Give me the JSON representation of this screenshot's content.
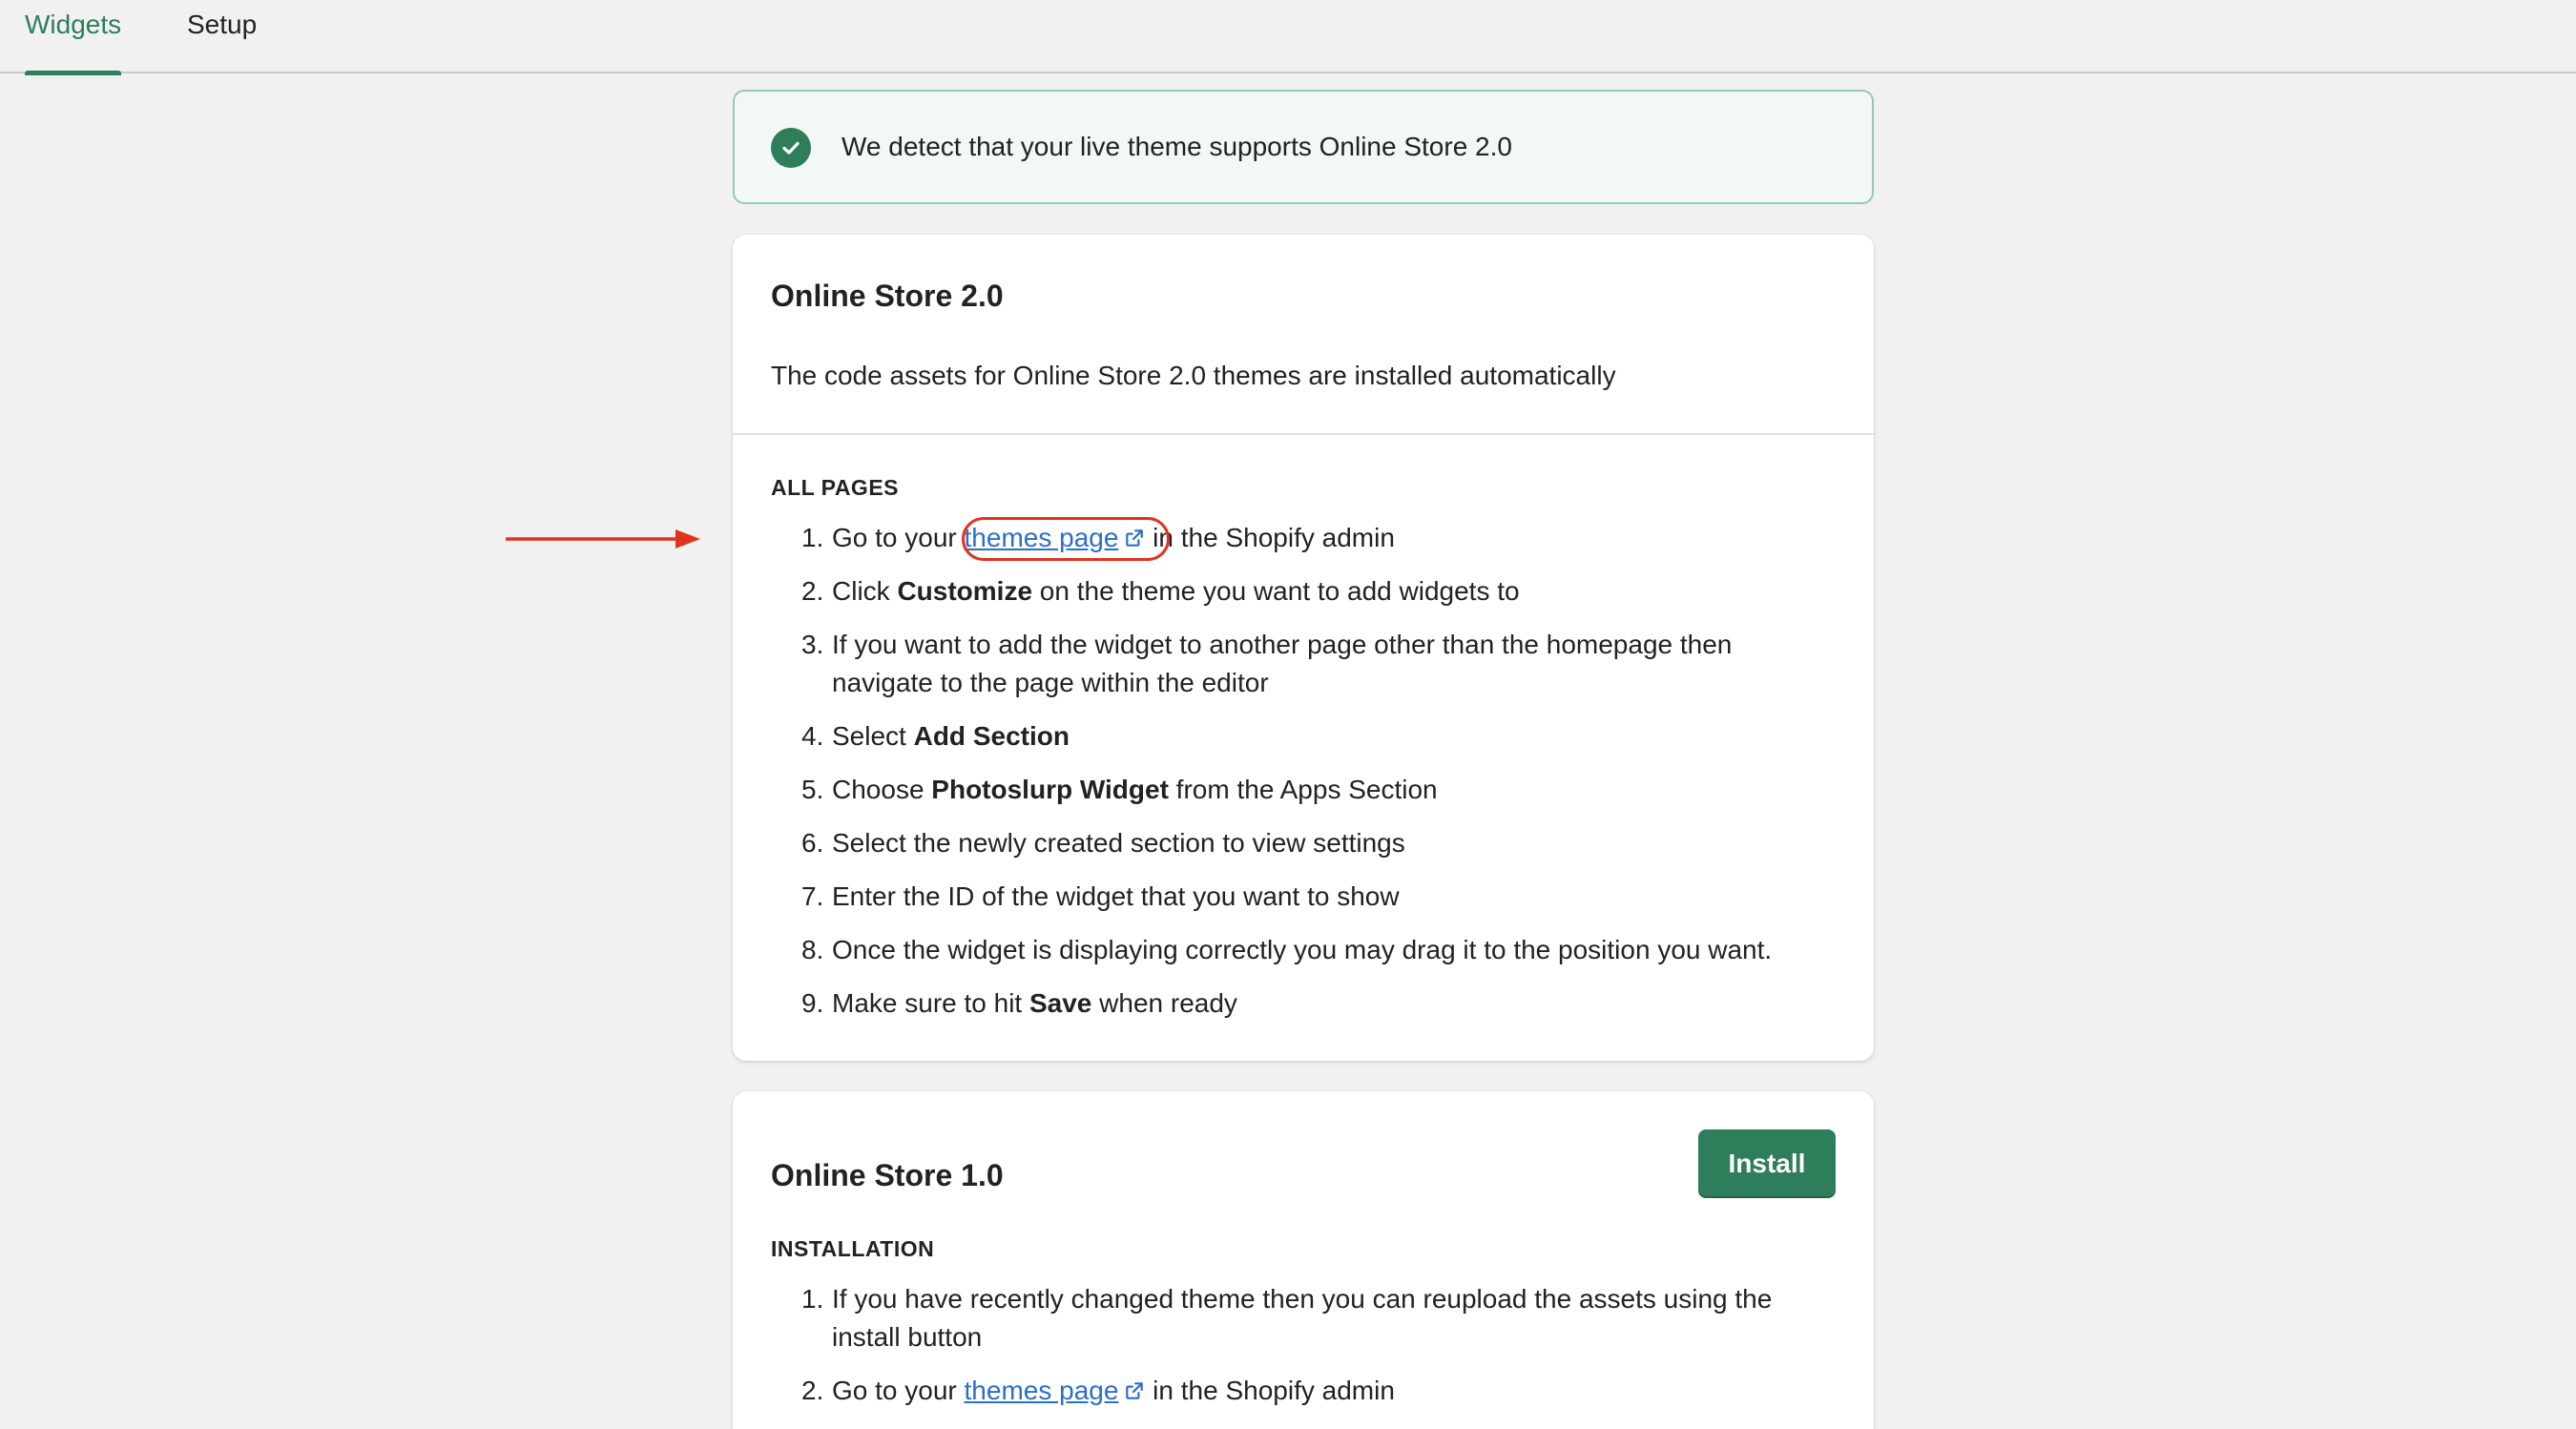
{
  "tabs": [
    {
      "label": "Widgets",
      "active": true
    },
    {
      "label": "Setup",
      "active": false
    }
  ],
  "banner": {
    "text": "We detect that your live theme supports Online Store 2.0",
    "icon": "checkmark-circle-icon"
  },
  "os2": {
    "title": "Online Store 2.0",
    "description": "The code assets for Online Store 2.0 themes are installed automatically",
    "section_label": "ALL PAGES",
    "steps": [
      {
        "num": "1.",
        "pre": "Go to your ",
        "link": "themes page",
        "post": " in the Shopify admin"
      },
      {
        "num": "2.",
        "pre": "Click ",
        "bold": "Customize",
        "post": " on the theme you want to add widgets to"
      },
      {
        "num": "3.",
        "text": "If you want to add the widget to another page other than the homepage then navigate to the page within the editor"
      },
      {
        "num": "4.",
        "pre": "Select ",
        "bold": "Add Section",
        "post": ""
      },
      {
        "num": "5.",
        "pre": "Choose ",
        "bold": "Photoslurp Widget",
        "post": " from the Apps Section"
      },
      {
        "num": "6.",
        "text": "Select the newly created section to view settings"
      },
      {
        "num": "7.",
        "text": "Enter the ID of the widget that you want to show"
      },
      {
        "num": "8.",
        "text": "Once the widget is displaying correctly you may drag it to the position you want."
      },
      {
        "num": "9.",
        "pre": "Make sure to hit ",
        "bold": "Save",
        "post": " when ready"
      }
    ]
  },
  "os1": {
    "title": "Online Store 1.0",
    "install_label": "Install",
    "section_label": "INSTALLATION",
    "steps": [
      {
        "num": "1.",
        "text": "If you have recently changed theme then you can reupload the assets using the install button"
      },
      {
        "num": "2.",
        "pre": "Go to your ",
        "link": "themes page",
        "post": " in the Shopify admin"
      }
    ]
  },
  "colors": {
    "accent": "#2e7d5b",
    "link": "#2c6ecb",
    "annotation": "#e0331f",
    "banner_bg": "#f1f8f5"
  }
}
